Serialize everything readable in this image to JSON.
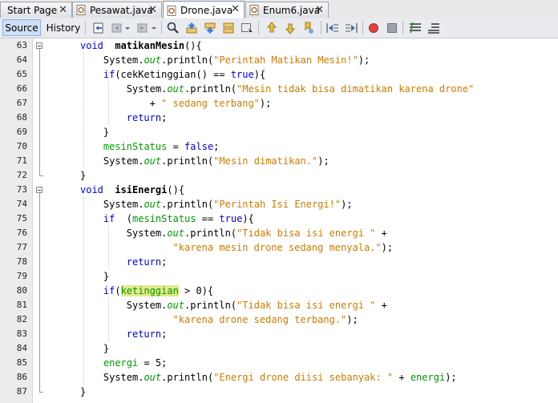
{
  "tabs": [
    {
      "label": "Start Page",
      "icon": "none",
      "active": false
    },
    {
      "label": "Pesawat.java",
      "icon": "java-file-icon",
      "active": false
    },
    {
      "label": "Drone.java",
      "icon": "java-file-icon",
      "active": true
    },
    {
      "label": "Enum6.java",
      "icon": "java-file-icon",
      "active": false
    }
  ],
  "close_glyph": "✕",
  "toolbar": {
    "source_label": "Source",
    "history_label": "History"
  },
  "lines": [
    {
      "num": "63",
      "indent": 2,
      "parts": [
        [
          "kw",
          "void"
        ],
        [
          "",
          "  "
        ],
        [
          "bold",
          "matikanMesin"
        ],
        [
          "",
          "(){"
        ]
      ]
    },
    {
      "num": "64",
      "indent": 3,
      "parts": [
        [
          "",
          "System."
        ],
        [
          "ital",
          "out"
        ],
        [
          "",
          ".println("
        ],
        [
          "str",
          "\"Perintah Matikan Mesin!\""
        ],
        [
          "",
          ");"
        ]
      ]
    },
    {
      "num": "65",
      "indent": 3,
      "parts": [
        [
          "kw",
          "if"
        ],
        [
          "",
          "(cekKetinggian() == "
        ],
        [
          "kw",
          "true"
        ],
        [
          "",
          "){"
        ]
      ]
    },
    {
      "num": "66",
      "indent": 4,
      "parts": [
        [
          "",
          "System."
        ],
        [
          "ital",
          "out"
        ],
        [
          "",
          ".println("
        ],
        [
          "str",
          "\"Mesin tidak bisa dimatikan karena drone\""
        ]
      ]
    },
    {
      "num": "67",
      "indent": 5,
      "parts": [
        [
          "",
          "+ "
        ],
        [
          "str",
          "\" sedang terbang\""
        ],
        [
          "",
          ");"
        ]
      ]
    },
    {
      "num": "68",
      "indent": 4,
      "parts": [
        [
          "kw",
          "return"
        ],
        [
          "",
          ";"
        ]
      ]
    },
    {
      "num": "69",
      "indent": 3,
      "parts": [
        [
          "",
          "}"
        ]
      ]
    },
    {
      "num": "70",
      "indent": 3,
      "parts": [
        [
          "fld",
          "mesinStatus"
        ],
        [
          "",
          " = "
        ],
        [
          "kw",
          "false"
        ],
        [
          "",
          ";"
        ]
      ]
    },
    {
      "num": "71",
      "indent": 3,
      "parts": [
        [
          "",
          "System."
        ],
        [
          "ital",
          "out"
        ],
        [
          "",
          ".println("
        ],
        [
          "str",
          "\"Mesin dimatikan.\""
        ],
        [
          "",
          ");"
        ]
      ]
    },
    {
      "num": "72",
      "indent": 2,
      "parts": [
        [
          "",
          "}"
        ]
      ]
    },
    {
      "num": "73",
      "indent": 2,
      "parts": [
        [
          "kw",
          "void"
        ],
        [
          "",
          "  "
        ],
        [
          "bold",
          "isiEnergi"
        ],
        [
          "",
          "(){"
        ]
      ]
    },
    {
      "num": "74",
      "indent": 3,
      "parts": [
        [
          "",
          "System."
        ],
        [
          "ital",
          "out"
        ],
        [
          "",
          ".println("
        ],
        [
          "str",
          "\"Perintah Isi Energi!\""
        ],
        [
          "",
          ");"
        ]
      ]
    },
    {
      "num": "75",
      "indent": 3,
      "parts": [
        [
          "kw",
          "if"
        ],
        [
          "",
          "  ("
        ],
        [
          "fld",
          "mesinStatus"
        ],
        [
          "",
          " == "
        ],
        [
          "kw",
          "true"
        ],
        [
          "",
          "){"
        ]
      ]
    },
    {
      "num": "76",
      "indent": 4,
      "parts": [
        [
          "",
          "System."
        ],
        [
          "ital",
          "out"
        ],
        [
          "",
          ".println("
        ],
        [
          "str",
          "\"Tidak bisa isi energi \""
        ],
        [
          "",
          " +"
        ]
      ]
    },
    {
      "num": "77",
      "indent": 6,
      "parts": [
        [
          "str",
          "\"karena mesin drone sedang menyala.\""
        ],
        [
          "",
          ");"
        ]
      ]
    },
    {
      "num": "78",
      "indent": 4,
      "parts": [
        [
          "kw",
          "return"
        ],
        [
          "",
          ";"
        ]
      ]
    },
    {
      "num": "79",
      "indent": 3,
      "parts": [
        [
          "",
          "}"
        ]
      ]
    },
    {
      "num": "80",
      "indent": 3,
      "parts": [
        [
          "kw",
          "if"
        ],
        [
          "",
          "("
        ],
        [
          "fld hl",
          "ketinggian"
        ],
        [
          "",
          " > 0){"
        ]
      ]
    },
    {
      "num": "81",
      "indent": 4,
      "parts": [
        [
          "",
          "System."
        ],
        [
          "ital",
          "out"
        ],
        [
          "",
          ".println("
        ],
        [
          "str",
          "\"Tidak bisa isi energi \""
        ],
        [
          "",
          " +"
        ]
      ]
    },
    {
      "num": "82",
      "indent": 6,
      "parts": [
        [
          "str",
          "\"karena drone sedang terbang.\""
        ],
        [
          "",
          ");"
        ]
      ]
    },
    {
      "num": "83",
      "indent": 4,
      "parts": [
        [
          "kw",
          "return"
        ],
        [
          "",
          ";"
        ]
      ]
    },
    {
      "num": "84",
      "indent": 3,
      "parts": [
        [
          "",
          "}"
        ]
      ]
    },
    {
      "num": "85",
      "indent": 3,
      "parts": [
        [
          "fld",
          "energi"
        ],
        [
          "",
          " = 5;"
        ]
      ]
    },
    {
      "num": "86",
      "indent": 3,
      "parts": [
        [
          "",
          "System."
        ],
        [
          "ital",
          "out"
        ],
        [
          "",
          ".println("
        ],
        [
          "str",
          "\"Energi drone diisi sebanyak: \""
        ],
        [
          "",
          " + "
        ],
        [
          "fld",
          "energi"
        ],
        [
          "",
          ");"
        ]
      ]
    },
    {
      "num": "87",
      "indent": 2,
      "parts": [
        [
          "",
          "}"
        ]
      ]
    }
  ]
}
